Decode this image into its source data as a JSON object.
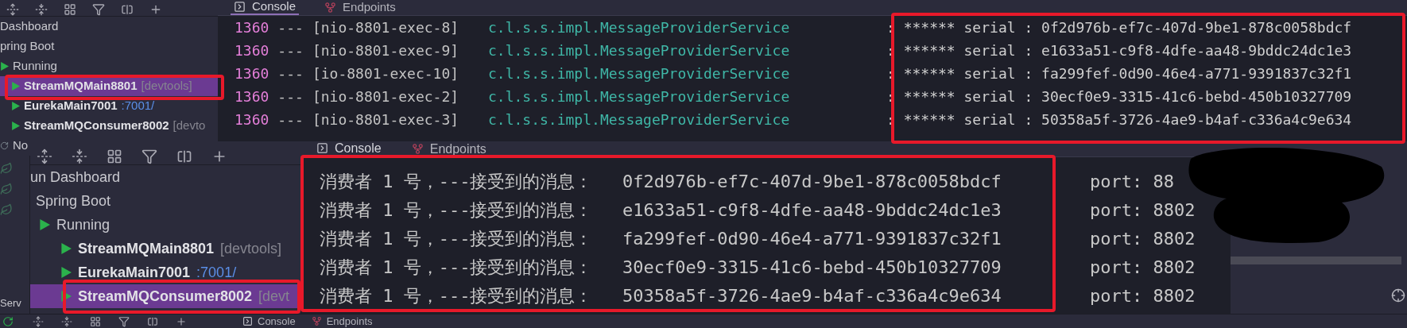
{
  "top_panel": {
    "tree": [
      {
        "label": "Dashboard",
        "kind": "group",
        "children": [
          {
            "label": "pring Boot",
            "kind": "group",
            "children": [
              {
                "label": "Running",
                "kind": "status",
                "children": [
                  {
                    "label": "StreamMQMain8801",
                    "kind": "app",
                    "suffix": {
                      "text": "[devtools]",
                      "kind": "config"
                    },
                    "selected": true
                  },
                  {
                    "label": "EurekaMain7001",
                    "kind": "app",
                    "suffix": {
                      "text": ":7001/",
                      "kind": "url"
                    },
                    "selected": false
                  },
                  {
                    "label": "StreamMQConsumer8002",
                    "kind": "app",
                    "suffix": {
                      "text": "[devto",
                      "kind": "config"
                    },
                    "selected": false
                  }
                ]
              }
            ]
          },
          {
            "label": "No",
            "kind": "idle"
          }
        ]
      }
    ],
    "console": {
      "tabs": [
        {
          "label": "Console",
          "selected": true
        },
        {
          "label": "Endpoints",
          "selected": false
        }
      ],
      "lines": [
        {
          "pid": "1360",
          "separator": "---",
          "thread": "[nio-8801-exec-8]",
          "logger": "c.l.s.s.impl.MessageProviderService",
          "message": ": ****** serial : 0f2d976b-ef7c-407d-9be1-878c0058bdcf"
        },
        {
          "pid": "1360",
          "separator": "---",
          "thread": "[nio-8801-exec-9]",
          "logger": "c.l.s.s.impl.MessageProviderService",
          "message": ": ****** serial : e1633a51-c9f8-4dfe-aa48-9bddc24dc1e3"
        },
        {
          "pid": "1360",
          "separator": "---",
          "thread": "[io-8801-exec-10]",
          "logger": "c.l.s.s.impl.MessageProviderService",
          "message": ": ****** serial : fa299fef-0d90-46e4-a771-9391837c32f1"
        },
        {
          "pid": "1360",
          "separator": "---",
          "thread": "[nio-8801-exec-2]",
          "logger": "c.l.s.s.impl.MessageProviderService",
          "message": ": ****** serial : 30ecf0e9-3315-41c6-bebd-450b10327709"
        },
        {
          "pid": "1360",
          "separator": "---",
          "thread": "[nio-8801-exec-3]",
          "logger": "c.l.s.s.impl.MessageProviderService",
          "message": ": ****** serial : 50358a5f-3726-4ae9-b4af-c336a4c9e634"
        }
      ]
    }
  },
  "bottom_panel": {
    "tree": [
      {
        "label": "un Dashboard",
        "kind": "group",
        "children": [
          {
            "label": "Spring Boot",
            "kind": "group",
            "children": [
              {
                "label": "Running",
                "kind": "status",
                "children": [
                  {
                    "label": "StreamMQMain8801",
                    "kind": "app",
                    "suffix": {
                      "text": "[devtools]",
                      "kind": "config"
                    },
                    "selected": false
                  },
                  {
                    "label": "EurekaMain7001",
                    "kind": "app",
                    "suffix": {
                      "text": ":7001/",
                      "kind": "url"
                    },
                    "selected": false
                  },
                  {
                    "label": "StreamMQConsumer8002",
                    "kind": "app",
                    "suffix": {
                      "text": "[devt",
                      "kind": "config"
                    },
                    "selected": true
                  }
                ]
              }
            ]
          }
        ]
      }
    ],
    "console": {
      "tabs": [
        {
          "label": "Console",
          "selected": true
        },
        {
          "label": "Endpoints",
          "selected": false
        }
      ],
      "lines": [
        {
          "text": "消费者 1 号，---接受到的消息：",
          "message_id": "0f2d976b-ef7c-407d-9be1-878c0058bdcf",
          "port": "port: 88"
        },
        {
          "text": "消费者 1 号，---接受到的消息：",
          "message_id": "e1633a51-c9f8-4dfe-aa48-9bddc24dc1e3",
          "port": "port: 8802"
        },
        {
          "text": "消费者 1 号，---接受到的消息：",
          "message_id": "fa299fef-0d90-46e4-a771-9391837c32f1",
          "port": "port: 8802"
        },
        {
          "text": "消费者 1 号，---接受到的消息：",
          "message_id": "30ecf0e9-3315-41c6-bebd-450b10327709",
          "port": "port: 8802"
        },
        {
          "text": "消费者 1 号，---接受到的消息：",
          "message_id": "50358a5f-3726-4ae9-b4af-c336a4c9e634",
          "port": "port: 8802"
        }
      ]
    }
  },
  "side_panel": {
    "label": "Serv"
  },
  "bottom_strip": {
    "tabs": [
      {
        "label": "Console"
      },
      {
        "label": "Endpoints"
      }
    ]
  }
}
